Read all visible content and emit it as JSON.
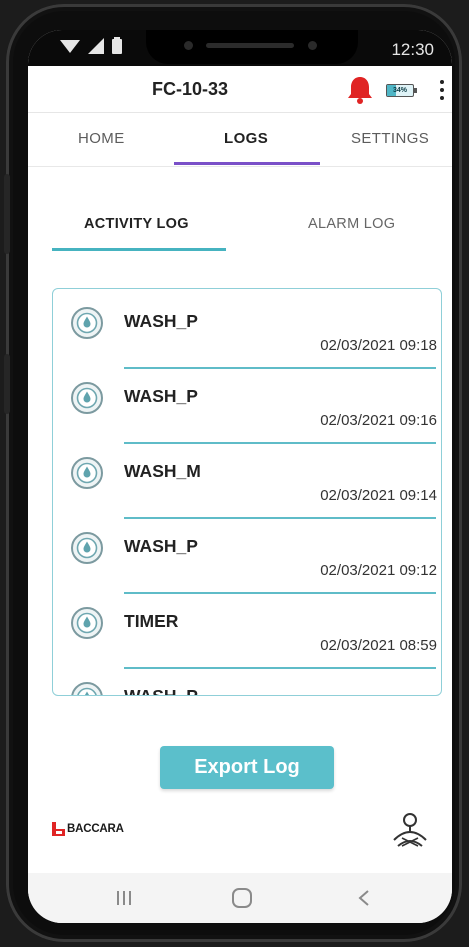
{
  "status_bar": {
    "time": "12:30"
  },
  "app_bar": {
    "device_title": "FC-10-33",
    "battery_level": "34%"
  },
  "main_tabs": [
    {
      "label": "HOME",
      "active": false
    },
    {
      "label": "LOGS",
      "active": true
    },
    {
      "label": "SETTINGS",
      "active": false
    }
  ],
  "sub_tabs": [
    {
      "label": "ACTIVITY LOG",
      "active": true
    },
    {
      "label": "ALARM LOG",
      "active": false
    }
  ],
  "activity_log": [
    {
      "name": "WASH_P",
      "timestamp": "02/03/2021 09:18"
    },
    {
      "name": "WASH_P",
      "timestamp": "02/03/2021 09:16"
    },
    {
      "name": "WASH_M",
      "timestamp": "02/03/2021 09:14"
    },
    {
      "name": "WASH_P",
      "timestamp": "02/03/2021 09:12"
    },
    {
      "name": "TIMER",
      "timestamp": "02/03/2021 08:59"
    },
    {
      "name": "WASH_P",
      "timestamp": ""
    }
  ],
  "export_button": {
    "label": "Export Log"
  },
  "brand": {
    "name": "BACCARA"
  },
  "colors": {
    "accent_teal": "#5bbfcb",
    "tab_indicator_purple": "#7a50c8",
    "alarm_bell_red": "#e02424"
  },
  "icons": {
    "log_item": "water-drop-icon",
    "alarm": "bell-icon",
    "menu": "more-vertical-icon",
    "nav_recents": "recents-icon",
    "nav_home": "home-icon",
    "nav_back": "back-icon"
  }
}
